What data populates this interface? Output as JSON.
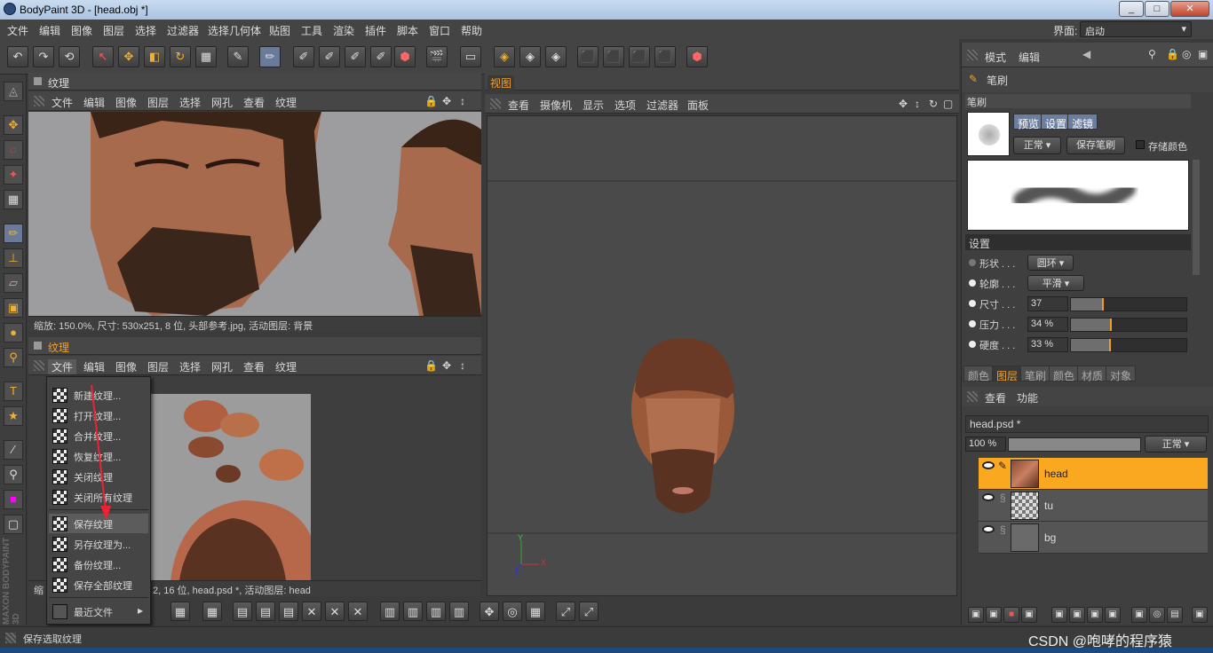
{
  "window": {
    "title": "BodyPaint 3D - [head.obj *]",
    "min": "_",
    "max": "□",
    "close": "✕"
  },
  "menubar": {
    "items": [
      "文件",
      "编辑",
      "图像",
      "图层",
      "选择",
      "过滤器",
      "选择几何体",
      "贴图",
      "工具",
      "渲染",
      "插件",
      "脚本",
      "窗口",
      "帮助"
    ],
    "layout_label": "界面:",
    "layout_value": "启动"
  },
  "texture_panel_top": {
    "title": "纹理",
    "menu": [
      "文件",
      "编辑",
      "图像",
      "图层",
      "选择",
      "网孔",
      "查看",
      "纹理"
    ],
    "status": "缩放: 150.0%, 尺寸: 530x251, 8 位, 头部参考.jpg, 活动图层: 背景"
  },
  "texture_panel_bottom": {
    "title": "纹理",
    "menu": [
      "文件",
      "编辑",
      "图像",
      "图层",
      "选择",
      "网孔",
      "查看",
      "纹理"
    ],
    "status_left": "缩",
    "status": "2, 16 位, head.psd *, 活动图层: head"
  },
  "file_menu": {
    "items": [
      "新建纹理...",
      "打开纹理...",
      "合并纹理...",
      "恢复纹理...",
      "关闭纹理",
      "关闭所有纹理",
      "保存纹理",
      "另存纹理为...",
      "备份纹理...",
      "保存全部纹理",
      "最近文件"
    ],
    "highlighted": "保存纹理",
    "submenu_arrow": "▸"
  },
  "viewport": {
    "tab": "视图",
    "menu": [
      "查看",
      "摄像机",
      "显示",
      "选项",
      "过滤器",
      "面板"
    ],
    "axes": {
      "y": "Y",
      "x": "X",
      "z": "Z"
    }
  },
  "right_panel": {
    "mode_menu": [
      "模式",
      "编辑"
    ],
    "section_title": "笔刷",
    "brush_header": "笔刷",
    "brush_tabs": [
      "预览",
      "设置",
      "滤镜"
    ],
    "blend_mode": "正常",
    "save_brush": "保存笔刷",
    "store_color": "存储颜色",
    "settings_header": "设置",
    "props": [
      {
        "label": "形状 . . .",
        "value": "圆环"
      },
      {
        "label": "轮廓 . . .",
        "value": "平滑"
      },
      {
        "label": "尺寸 . . .",
        "value": "37",
        "level": 0.27
      },
      {
        "label": "压力 . . .",
        "value": "34 %",
        "level": 0.34
      },
      {
        "label": "硬度 . . .",
        "value": "33 %",
        "level": 0.33
      }
    ],
    "bottom_tabs": [
      "颜色",
      "图层",
      "笔刷",
      "颜色",
      "材质",
      "对象"
    ],
    "active_bottom_tab": "图层",
    "layers_menu": [
      "查看",
      "功能"
    ],
    "doc_name": "head.psd *",
    "opacity": "100 %",
    "layer_blend": "正常",
    "layers": [
      "head",
      "tu",
      "bg"
    ]
  },
  "statusbar": {
    "text": "保存选取纹理",
    "watermark": "CSDN @咆哮的程序猿"
  },
  "colors": {
    "accent": "#f0a020",
    "active_layer": "#f9a820",
    "panel": "#3b3b3b"
  }
}
